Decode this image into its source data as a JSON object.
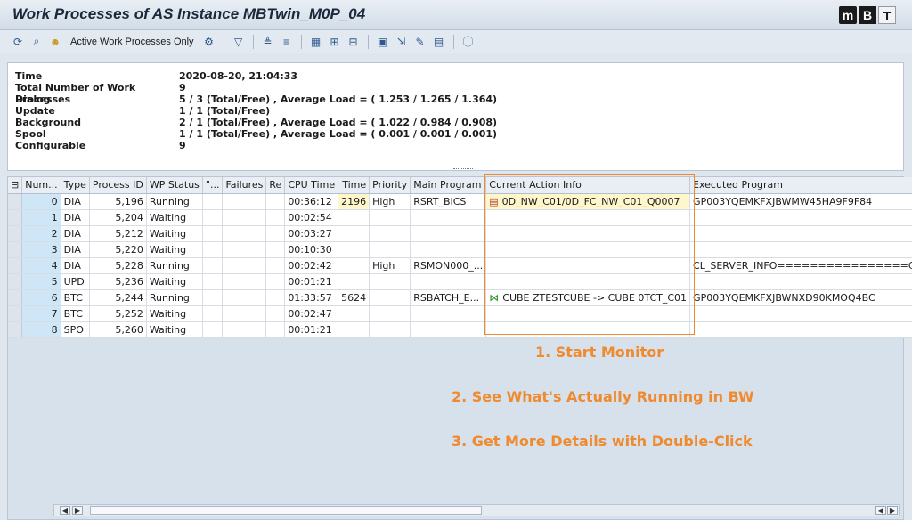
{
  "title": "Work Processes of AS Instance MBTwin_M0P_04",
  "logo": [
    "m",
    "B",
    "T"
  ],
  "toolbar": {
    "active_only_label": "Active Work Processes Only"
  },
  "header": {
    "rows": [
      {
        "label": "Time",
        "value": "2020-08-20, 21:04:33"
      },
      {
        "label": "Total Number of Work Processes",
        "value": "9"
      },
      {
        "label": "Dialog",
        "value": "5 / 3 (Total/Free) , Average Load = ( 1.253 / 1.265 / 1.364)"
      },
      {
        "label": "Update",
        "value": "1 / 1 (Total/Free)"
      },
      {
        "label": "Background",
        "value": "2 / 1 (Total/Free) , Average Load = ( 1.022 / 0.984 / 0.908)"
      },
      {
        "label": "Spool",
        "value": "1 / 1 (Total/Free) , Average Load = ( 0.001 / 0.001 / 0.001)"
      },
      {
        "label": "Configurable",
        "value": "9"
      }
    ]
  },
  "grid": {
    "columns": [
      "Num...",
      "Type",
      "Process ID",
      "WP Status",
      "\"...",
      "Failures",
      "Re",
      "CPU Time",
      "Time",
      "Priority",
      "Main Program",
      "Current Action Info",
      "Executed Program"
    ],
    "rows": [
      {
        "num": "0",
        "type": "DIA",
        "pid": "5,196",
        "status": "Running",
        "cpu": "00:36:12",
        "time": "2196",
        "priority": "High",
        "main": "RSRT_BICS",
        "action": "0D_NW_C01/0D_FC_NW_C01_Q0007",
        "action_icon": "query-icon",
        "exec": "GP003YQEMKFXJBWMW45HA9F9F84"
      },
      {
        "num": "1",
        "type": "DIA",
        "pid": "5,204",
        "status": "Waiting",
        "cpu": "00:02:54",
        "time": "",
        "priority": "",
        "main": "",
        "action": "",
        "action_icon": "",
        "exec": ""
      },
      {
        "num": "2",
        "type": "DIA",
        "pid": "5,212",
        "status": "Waiting",
        "cpu": "00:03:27",
        "time": "",
        "priority": "",
        "main": "",
        "action": "",
        "action_icon": "",
        "exec": ""
      },
      {
        "num": "3",
        "type": "DIA",
        "pid": "5,220",
        "status": "Waiting",
        "cpu": "00:10:30",
        "time": "",
        "priority": "",
        "main": "",
        "action": "",
        "action_icon": "",
        "exec": ""
      },
      {
        "num": "4",
        "type": "DIA",
        "pid": "5,228",
        "status": "Running",
        "cpu": "00:02:42",
        "time": "",
        "priority": "High",
        "main": "RSMON000_...",
        "action": "",
        "action_icon": "",
        "exec": "CL_SERVER_INFO================CP"
      },
      {
        "num": "5",
        "type": "UPD",
        "pid": "5,236",
        "status": "Waiting",
        "cpu": "00:01:21",
        "time": "",
        "priority": "",
        "main": "",
        "action": "",
        "action_icon": "",
        "exec": ""
      },
      {
        "num": "6",
        "type": "BTC",
        "pid": "5,244",
        "status": "Running",
        "cpu": "01:33:57",
        "time": "5624",
        "priority": "",
        "main": "RSBATCH_E...",
        "action": "CUBE ZTESTCUBE -> CUBE 0TCT_C01",
        "action_icon": "transform-icon",
        "exec": "GP003YQEMKFXJBWNXD90KMOQ4BC"
      },
      {
        "num": "7",
        "type": "BTC",
        "pid": "5,252",
        "status": "Waiting",
        "cpu": "00:02:47",
        "time": "",
        "priority": "",
        "main": "",
        "action": "",
        "action_icon": "",
        "exec": ""
      },
      {
        "num": "8",
        "type": "SPO",
        "pid": "5,260",
        "status": "Waiting",
        "cpu": "00:01:21",
        "time": "",
        "priority": "",
        "main": "",
        "action": "",
        "action_icon": "",
        "exec": ""
      }
    ]
  },
  "callouts": [
    "1. Start Monitor",
    "2. See What's Actually Running in BW",
    "3. Get More Details with Double-Click"
  ],
  "colors": {
    "accent": "#f08a2e",
    "key_column": "#cfe6f7",
    "highlight": "#fff7cc"
  }
}
